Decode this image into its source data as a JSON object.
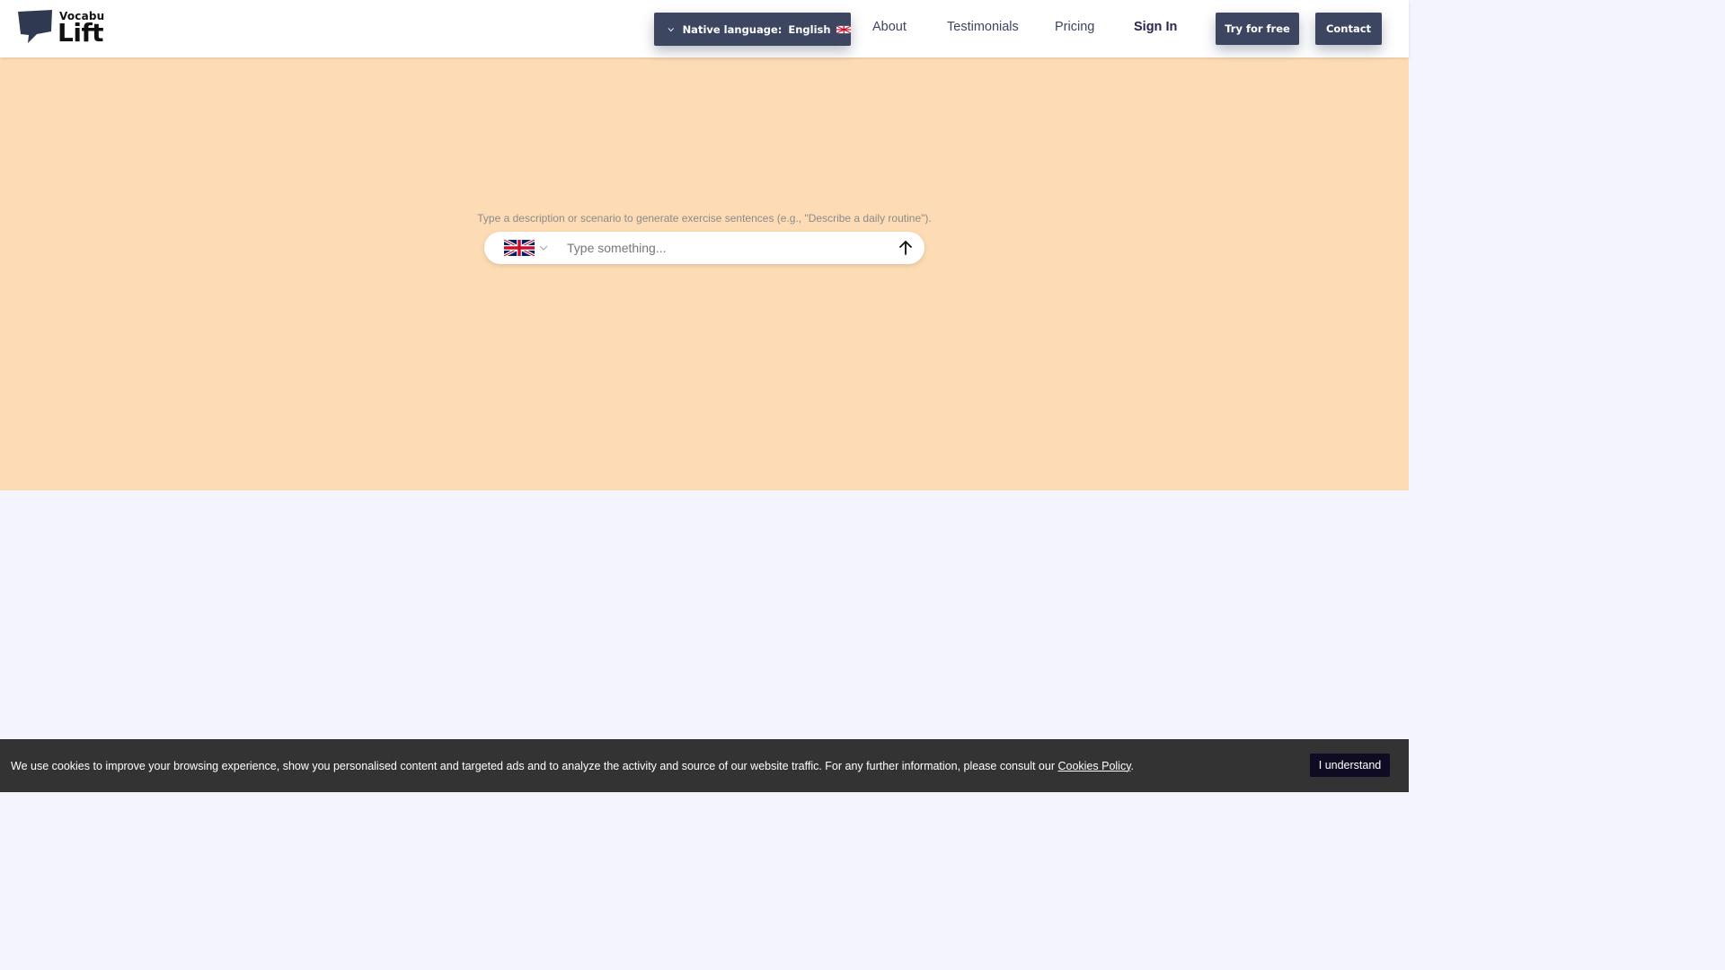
{
  "brand": {
    "top": "Vocabu",
    "bottom": "Lift"
  },
  "header": {
    "native_language_label": "Native language:",
    "native_language_value": "English",
    "nav": {
      "about": "About",
      "testimonials": "Testimonials",
      "pricing": "Pricing",
      "sign_in": "Sign In"
    },
    "try_for_free": "Try for free",
    "contact": "Contact"
  },
  "hero": {
    "hint": "Type a description or scenario to generate exercise sentences (e.g., \"Describe a daily routine\").",
    "input_placeholder": "Type something...",
    "input_value": "",
    "selected_language_icon": "uk-flag-icon"
  },
  "cookie": {
    "text": "We use cookies to improve your browsing experience, show you personalised content and targeted ads and to analyze the activity and source of our website traffic. For any further information, please consult our ",
    "link": "Cookies Policy",
    "trailing": ".",
    "button": "I understand"
  },
  "colors": {
    "header_bg": "#ffffff",
    "accent_dark": "#3d4661",
    "hero_bg": "#fddcb5",
    "page_bg": "#f3f4fd",
    "cookie_bg": "#333333",
    "cookie_button": "#0f0b22"
  }
}
